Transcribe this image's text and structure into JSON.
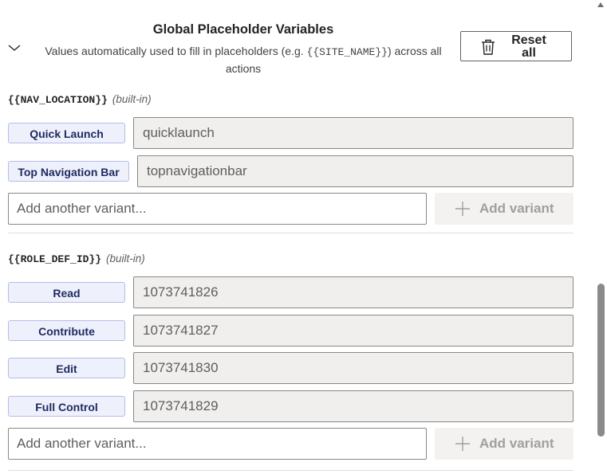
{
  "header": {
    "title": "Global Placeholder Variables",
    "subtitle_before": "Values automatically used to fill in placeholders (e.g. ",
    "subtitle_code": "{{SITE_NAME}}",
    "subtitle_after": ") across all actions",
    "reset_label": "Reset all"
  },
  "sections": [
    {
      "variable": "{{NAV_LOCATION}}",
      "tag": "(built-in)",
      "variants": [
        {
          "label": "Quick Launch",
          "value": "quicklaunch"
        },
        {
          "label": "Top Navigation Bar",
          "value": "topnavigationbar"
        }
      ],
      "add_placeholder": "Add another variant...",
      "add_button": "Add variant"
    },
    {
      "variable": "{{ROLE_DEF_ID}}",
      "tag": "(built-in)",
      "variants": [
        {
          "label": "Read",
          "value": "1073741826"
        },
        {
          "label": "Contribute",
          "value": "1073741827"
        },
        {
          "label": "Edit",
          "value": "1073741830"
        },
        {
          "label": "Full Control",
          "value": "1073741829"
        }
      ],
      "add_placeholder": "Add another variant...",
      "add_button": "Add variant"
    }
  ]
}
